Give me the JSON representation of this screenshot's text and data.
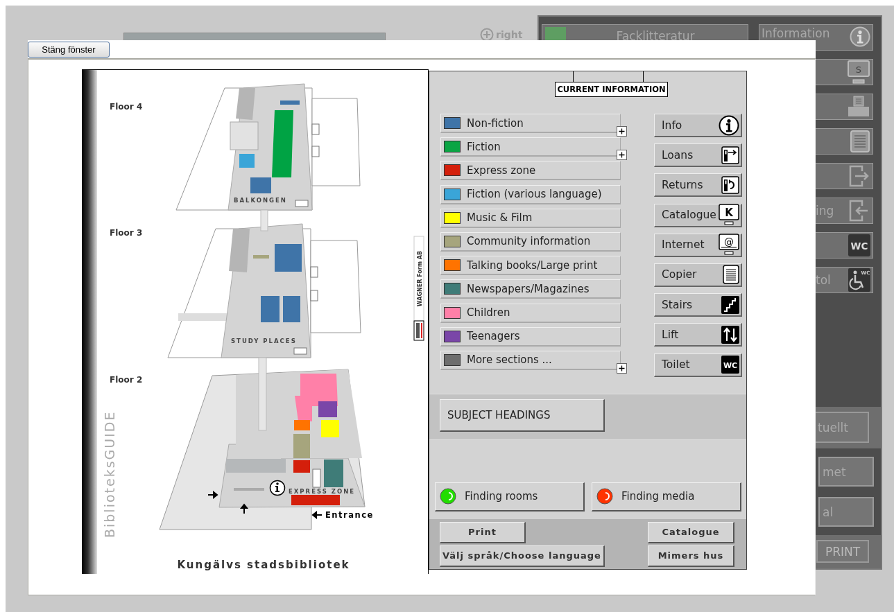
{
  "background": {
    "zoom_link": "right",
    "top_button": {
      "label": "Facklitteratur",
      "color": "#5e9e62"
    },
    "side_buttons": [
      {
        "label": "Information",
        "kind": "info"
      },
      {
        "kind": "screen",
        "glyph": "S"
      },
      {
        "kind": "printer"
      },
      {
        "kind": "list"
      },
      {
        "kind": "exit"
      },
      {
        "label": "ing",
        "kind": "enter"
      },
      {
        "kind": "wc",
        "glyph": "WC"
      },
      {
        "label": "tol",
        "kind": "wheelchair",
        "glyph": "WC"
      }
    ],
    "bottom_buttons": [
      {
        "label": "tuellt",
        "kind": "band"
      },
      {
        "label": "met",
        "kind": "dark"
      },
      {
        "label": "al",
        "kind": "dark"
      },
      {
        "label": "PRINT",
        "kind": "band"
      }
    ]
  },
  "dialog": {
    "close_button": "Stäng fönster",
    "map": {
      "brand": "BiblioteksGUIDE",
      "title": "Kungälvs stadsbibliotek",
      "credit": "WAGNER Form AB",
      "entrance": "Entrance",
      "floors": [
        {
          "label": "Floor 4",
          "zone": "BALKONGEN"
        },
        {
          "label": "Floor 3",
          "zone": "STUDY PLACES"
        },
        {
          "label": "Floor 2",
          "zone": "EXPRESS ZONE"
        }
      ]
    },
    "panel": {
      "header": "CURRENT INFORMATION",
      "sections": [
        {
          "label": "Non-fiction",
          "color": "#3f74a8",
          "expandable": true
        },
        {
          "label": "Fiction",
          "color": "#0aa544",
          "expandable": true
        },
        {
          "label": "Express zone",
          "color": "#d41f0b",
          "expandable": false
        },
        {
          "label": "Fiction (various language)",
          "color": "#3aa5d8",
          "expandable": false
        },
        {
          "label": "Music & Film",
          "color": "#ffff00",
          "expandable": false
        },
        {
          "label": "Community information",
          "color": "#a6a57d",
          "expandable": false
        },
        {
          "label": "Talking books/Large print",
          "color": "#ff7300",
          "expandable": false
        },
        {
          "label": "Newspapers/Magazines",
          "color": "#3f7c78",
          "expandable": false
        },
        {
          "label": "Children",
          "color": "#ff80a8",
          "expandable": false
        },
        {
          "label": "Teenagers",
          "color": "#7a46a8",
          "expandable": false
        },
        {
          "label": "More sections ...",
          "color": "#6e6e6e",
          "expandable": true
        }
      ],
      "services": [
        {
          "label": "Info",
          "kind": "info"
        },
        {
          "label": "Loans",
          "kind": "loan"
        },
        {
          "label": "Returns",
          "kind": "return"
        },
        {
          "label": "Catalogue",
          "kind": "catalogue",
          "glyph": "K"
        },
        {
          "label": "Internet",
          "kind": "internet",
          "glyph": "@"
        },
        {
          "label": "Copier",
          "kind": "copier"
        },
        {
          "label": "Stairs",
          "kind": "stairs"
        },
        {
          "label": "Lift",
          "kind": "lift"
        },
        {
          "label": "Toilet",
          "kind": "wc",
          "glyph": "WC"
        }
      ],
      "subject_button": "SUBJECT HEADINGS",
      "finders": [
        {
          "label": "Finding rooms",
          "color": "#22dd00"
        },
        {
          "label": "Finding media",
          "color": "#ff3300"
        }
      ],
      "footer_left": [
        "Print",
        "Välj språk/Choose language"
      ],
      "footer_right": [
        "Catalogue",
        "Mimers hus"
      ]
    }
  }
}
